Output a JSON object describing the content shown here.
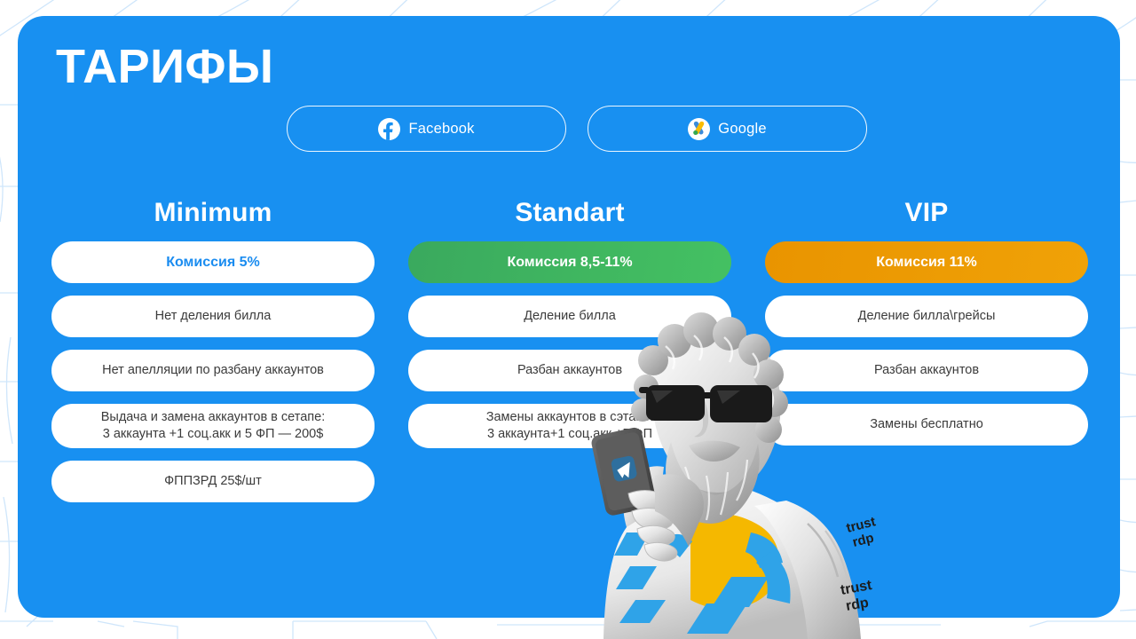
{
  "theme": {
    "background": "#ffffff",
    "card_bg": "#1890f1",
    "accent_blue": "#1a8cf0",
    "accent_green": "#3faf60",
    "accent_orange": "#eb9900",
    "pill_bg": "#ffffff",
    "text_dark": "#3b3b3b",
    "text_light": "#ffffff",
    "pattern_line": "#cfe6fb"
  },
  "header": {
    "title": "ТАРИФЫ"
  },
  "tabs": [
    {
      "id": "facebook",
      "label": "Facebook",
      "icon": "facebook-icon"
    },
    {
      "id": "google",
      "label": "Google",
      "icon": "google-ads-icon"
    }
  ],
  "plans": [
    {
      "id": "minimum",
      "title": "Minimum",
      "commission": {
        "label": "Комиссия 5%",
        "style": "accent-blue",
        "value": "5%"
      },
      "features": [
        "Нет деления билла",
        "Нет апелляции по разбану аккаунтов",
        "Выдача и замена аккаунтов в сетапе:\n3 аккаунта +1 соц.акк и 5 ФП — 200$",
        "ФППЗРД 25$/шт"
      ]
    },
    {
      "id": "standart",
      "title": "Standart",
      "commission": {
        "label": "Комиссия 8,5-11%",
        "style": "accent-green",
        "value": "8,5-11%"
      },
      "features": [
        "Деление билла",
        "Разбан аккаунтов",
        "Замены аккаунтов в сэтапе:\n3 аккаунта+1 соц.акк +5 ФП"
      ]
    },
    {
      "id": "vip",
      "title": "VIP",
      "commission": {
        "label": "Комиссия 11%",
        "style": "accent-orange",
        "value": "11%"
      },
      "features": [
        "Деление билла\\грейсы",
        "Разбан аккаунтов",
        "Замены бесплатно"
      ]
    }
  ],
  "mascot": {
    "name": "marble-statue-with-phone",
    "description": "Greek marble bust wearing black sunglasses, holding a smartphone showing a Telegram icon, wearing a t-shirt with yellow and blue graphics",
    "shirt_brand": "trust rdp",
    "phone_app_icon": "telegram-icon"
  }
}
